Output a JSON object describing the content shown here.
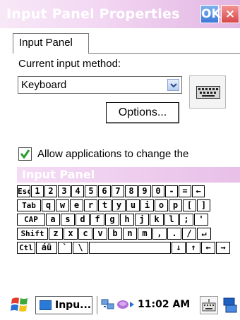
{
  "window": {
    "title": "Input Panel Properties",
    "ok_label": "OK",
    "close_label": "×"
  },
  "tabs": [
    {
      "label": "Input Panel",
      "selected": true
    }
  ],
  "panel": {
    "current_method_label": "Current input method:",
    "method_value": "Keyboard",
    "options_label": "Options...",
    "allow_change_label": "Allow applications to change the",
    "allow_change_checked": true
  },
  "input_panel": {
    "title": "Input Panel",
    "rows": [
      [
        "Esc",
        "1",
        "2",
        "3",
        "4",
        "5",
        "6",
        "7",
        "8",
        "9",
        "0",
        "-",
        "=",
        "←"
      ],
      [
        "Tab",
        "q",
        "w",
        "e",
        "r",
        "t",
        "y",
        "u",
        "i",
        "o",
        "p",
        "[",
        "]"
      ],
      [
        "CAP",
        "a",
        "s",
        "d",
        "f",
        "g",
        "h",
        "j",
        "k",
        "l",
        ";",
        "'"
      ],
      [
        "Shift",
        "z",
        "x",
        "c",
        "v",
        "b",
        "n",
        "m",
        ",",
        ".",
        "/",
        "↵"
      ],
      [
        "Ctl",
        "áü",
        "`",
        "\\",
        "",
        "↓",
        "↑",
        "←",
        "→"
      ]
    ]
  },
  "taskbar": {
    "task_label": "Inpu...",
    "clock": "11:02 AM",
    "icons": [
      "windows-start-icon",
      "input-panel-app-icon",
      "network-icon",
      "sync-icon",
      "keyboard-icon",
      "connectivity-icon"
    ]
  },
  "colors": {
    "titlebar": "#f3d8f3",
    "ok_button": "#3b78d8",
    "close_button": "#d94848",
    "checkbox_tick": "#2a9d2a"
  }
}
